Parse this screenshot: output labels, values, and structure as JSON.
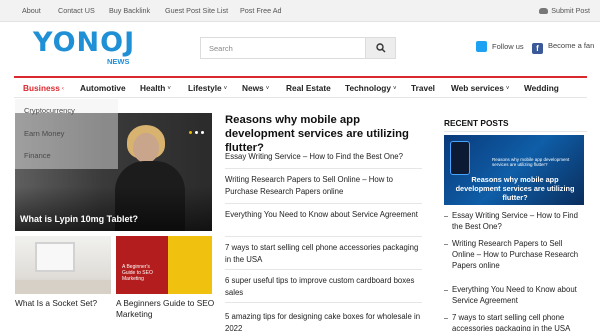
{
  "topbar": {
    "links": [
      "About",
      "Contact US",
      "Buy Backlink",
      "Guest Post Site List",
      "Post Free Ad"
    ],
    "submit_label": "Submit Post"
  },
  "brand": {
    "logo_main": "YONOJ",
    "logo_sub": "NEWS"
  },
  "search": {
    "placeholder": "Search"
  },
  "social": {
    "twitter_label": "Follow us",
    "facebook_label": "Become a fan"
  },
  "nav": {
    "items": [
      "Business",
      "Automotive",
      "Health",
      "Lifestyle",
      "News",
      "Real Estate",
      "Technology",
      "Travel",
      "Web services",
      "Wedding"
    ],
    "active": "Business"
  },
  "dropdown": {
    "items": [
      "Cryptocurrency",
      "Earn Money",
      "Finance"
    ]
  },
  "featured": {
    "hero_title": "What is Lypin 10mg Tablet?",
    "cards": [
      {
        "title": "What Is a Socket Set?"
      },
      {
        "title": "A Beginners Guide to SEO Marketing",
        "thumb_text": "A Beginner's Guide to SEO Marketing"
      }
    ]
  },
  "main": {
    "headline": "Reasons why mobile app development services are utilizing flutter?",
    "articles": [
      "Essay Writing Service – How to Find the Best One?",
      "Writing Research Papers to Sell Online – How to Purchase Research Papers online",
      "Everything You Need to Know about Service Agreement",
      "7 ways to start selling cell phone accessories packaging in the USA",
      "6 super useful tips to improve custom cardboard boxes sales",
      "5 amazing tips for designing cake boxes for wholesale in 2022"
    ]
  },
  "sidebar": {
    "heading": "RECENT POSTS",
    "featured_caption": "Reasons why mobile app development services are utilizing flutter?",
    "featured_mini": "Reasons why mobile app development services are utilizing flutter?",
    "posts": [
      "Essay Writing Service – How to Find the Best One?",
      "Writing Research Papers to Sell Online – How to Purchase Research Papers online",
      "Everything You Need to Know about Service Agreement",
      "7 ways to start selling cell phone accessories packaging in the USA"
    ]
  },
  "colors": {
    "accent": "#d9292e",
    "brand_blue": "#1f8fd6",
    "twitter": "#1da1f2",
    "facebook": "#3b5998"
  },
  "icons": {
    "search": "search-icon",
    "submit": "cloud-upload-icon",
    "twitter": "twitter-icon",
    "facebook": "facebook-icon"
  }
}
